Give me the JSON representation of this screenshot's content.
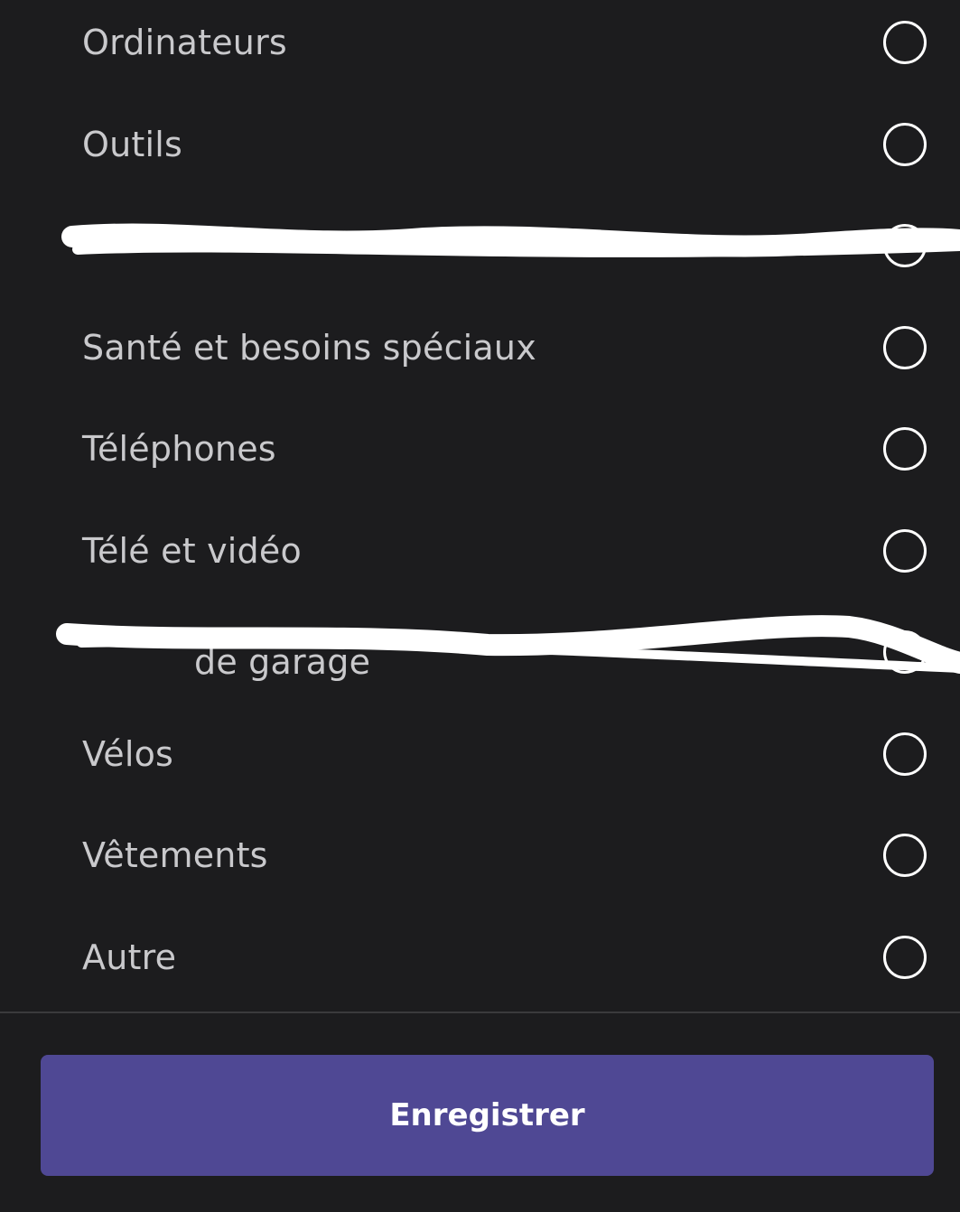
{
  "categories": [
    {
      "label": "Ordinateurs",
      "selected": false
    },
    {
      "label": "Outils",
      "selected": false
    },
    {
      "label": "",
      "selected": false
    },
    {
      "label": "Santé et besoins spéciaux",
      "selected": false
    },
    {
      "label": "Téléphones",
      "selected": false
    },
    {
      "label": "Télé et vidéo",
      "selected": false
    },
    {
      "label": "de garage",
      "selected": false
    },
    {
      "label": "Vélos",
      "selected": false
    },
    {
      "label": "Vêtements",
      "selected": false
    },
    {
      "label": "Autre",
      "selected": false
    }
  ],
  "footer": {
    "save_label": "Enregistrer"
  },
  "colors": {
    "background": "#1c1c1e",
    "text": "#c9c9cc",
    "radio_border": "#ffffff",
    "button": "#4f4894",
    "redaction": "#ffffff"
  }
}
